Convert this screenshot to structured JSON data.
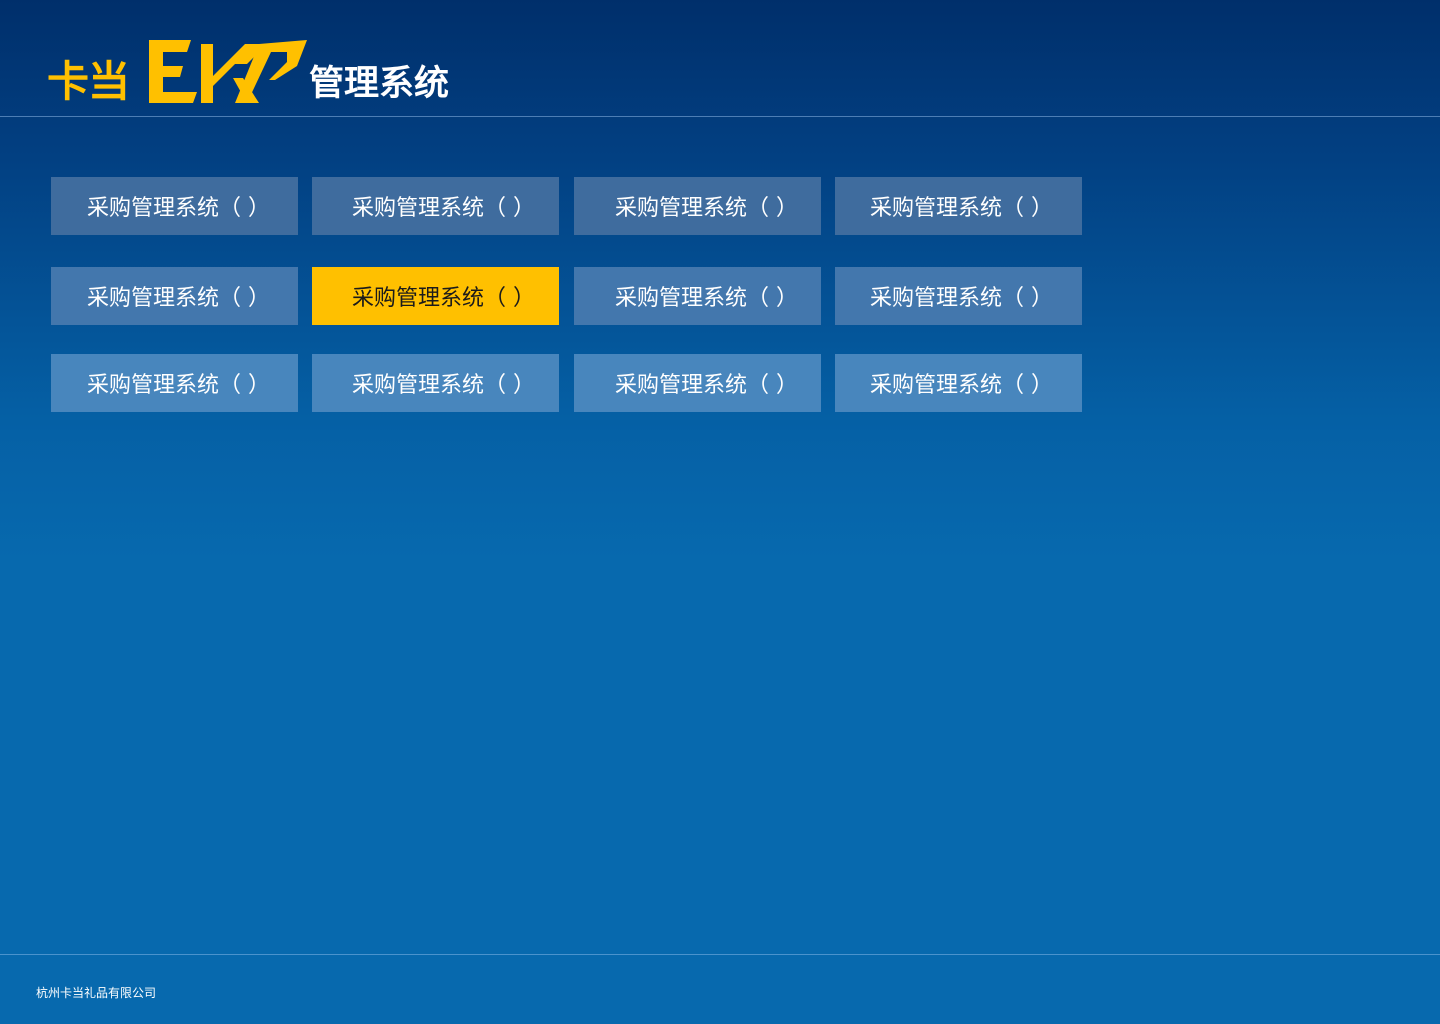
{
  "header": {
    "logo_cn": "卡当",
    "logo_erp": "ERP",
    "logo_suffix": "管理系统"
  },
  "tiles": [
    [
      {
        "label": "采购管理系统（ ）"
      },
      {
        "label": "采购管理系统（ ）"
      },
      {
        "label": "采购管理系统（ ）"
      },
      {
        "label": "采购管理系统（ ）"
      }
    ],
    [
      {
        "label": "采购管理系统（ ）"
      },
      {
        "label": "采购管理系统（ ）",
        "active": true
      },
      {
        "label": "采购管理系统（ ）"
      },
      {
        "label": "采购管理系统（ ）"
      }
    ],
    [
      {
        "label": "采购管理系统（ ）"
      },
      {
        "label": "采购管理系统（ ）"
      },
      {
        "label": "采购管理系统（ ）"
      },
      {
        "label": "采购管理系统（ ）"
      }
    ]
  ],
  "footer": {
    "company": "杭州卡当礼品有限公司"
  },
  "colors": {
    "brand_yellow": "#ffc000",
    "active_tile": "#ffc000",
    "background_top": "#002f6b",
    "background_bottom": "#0769ae"
  }
}
